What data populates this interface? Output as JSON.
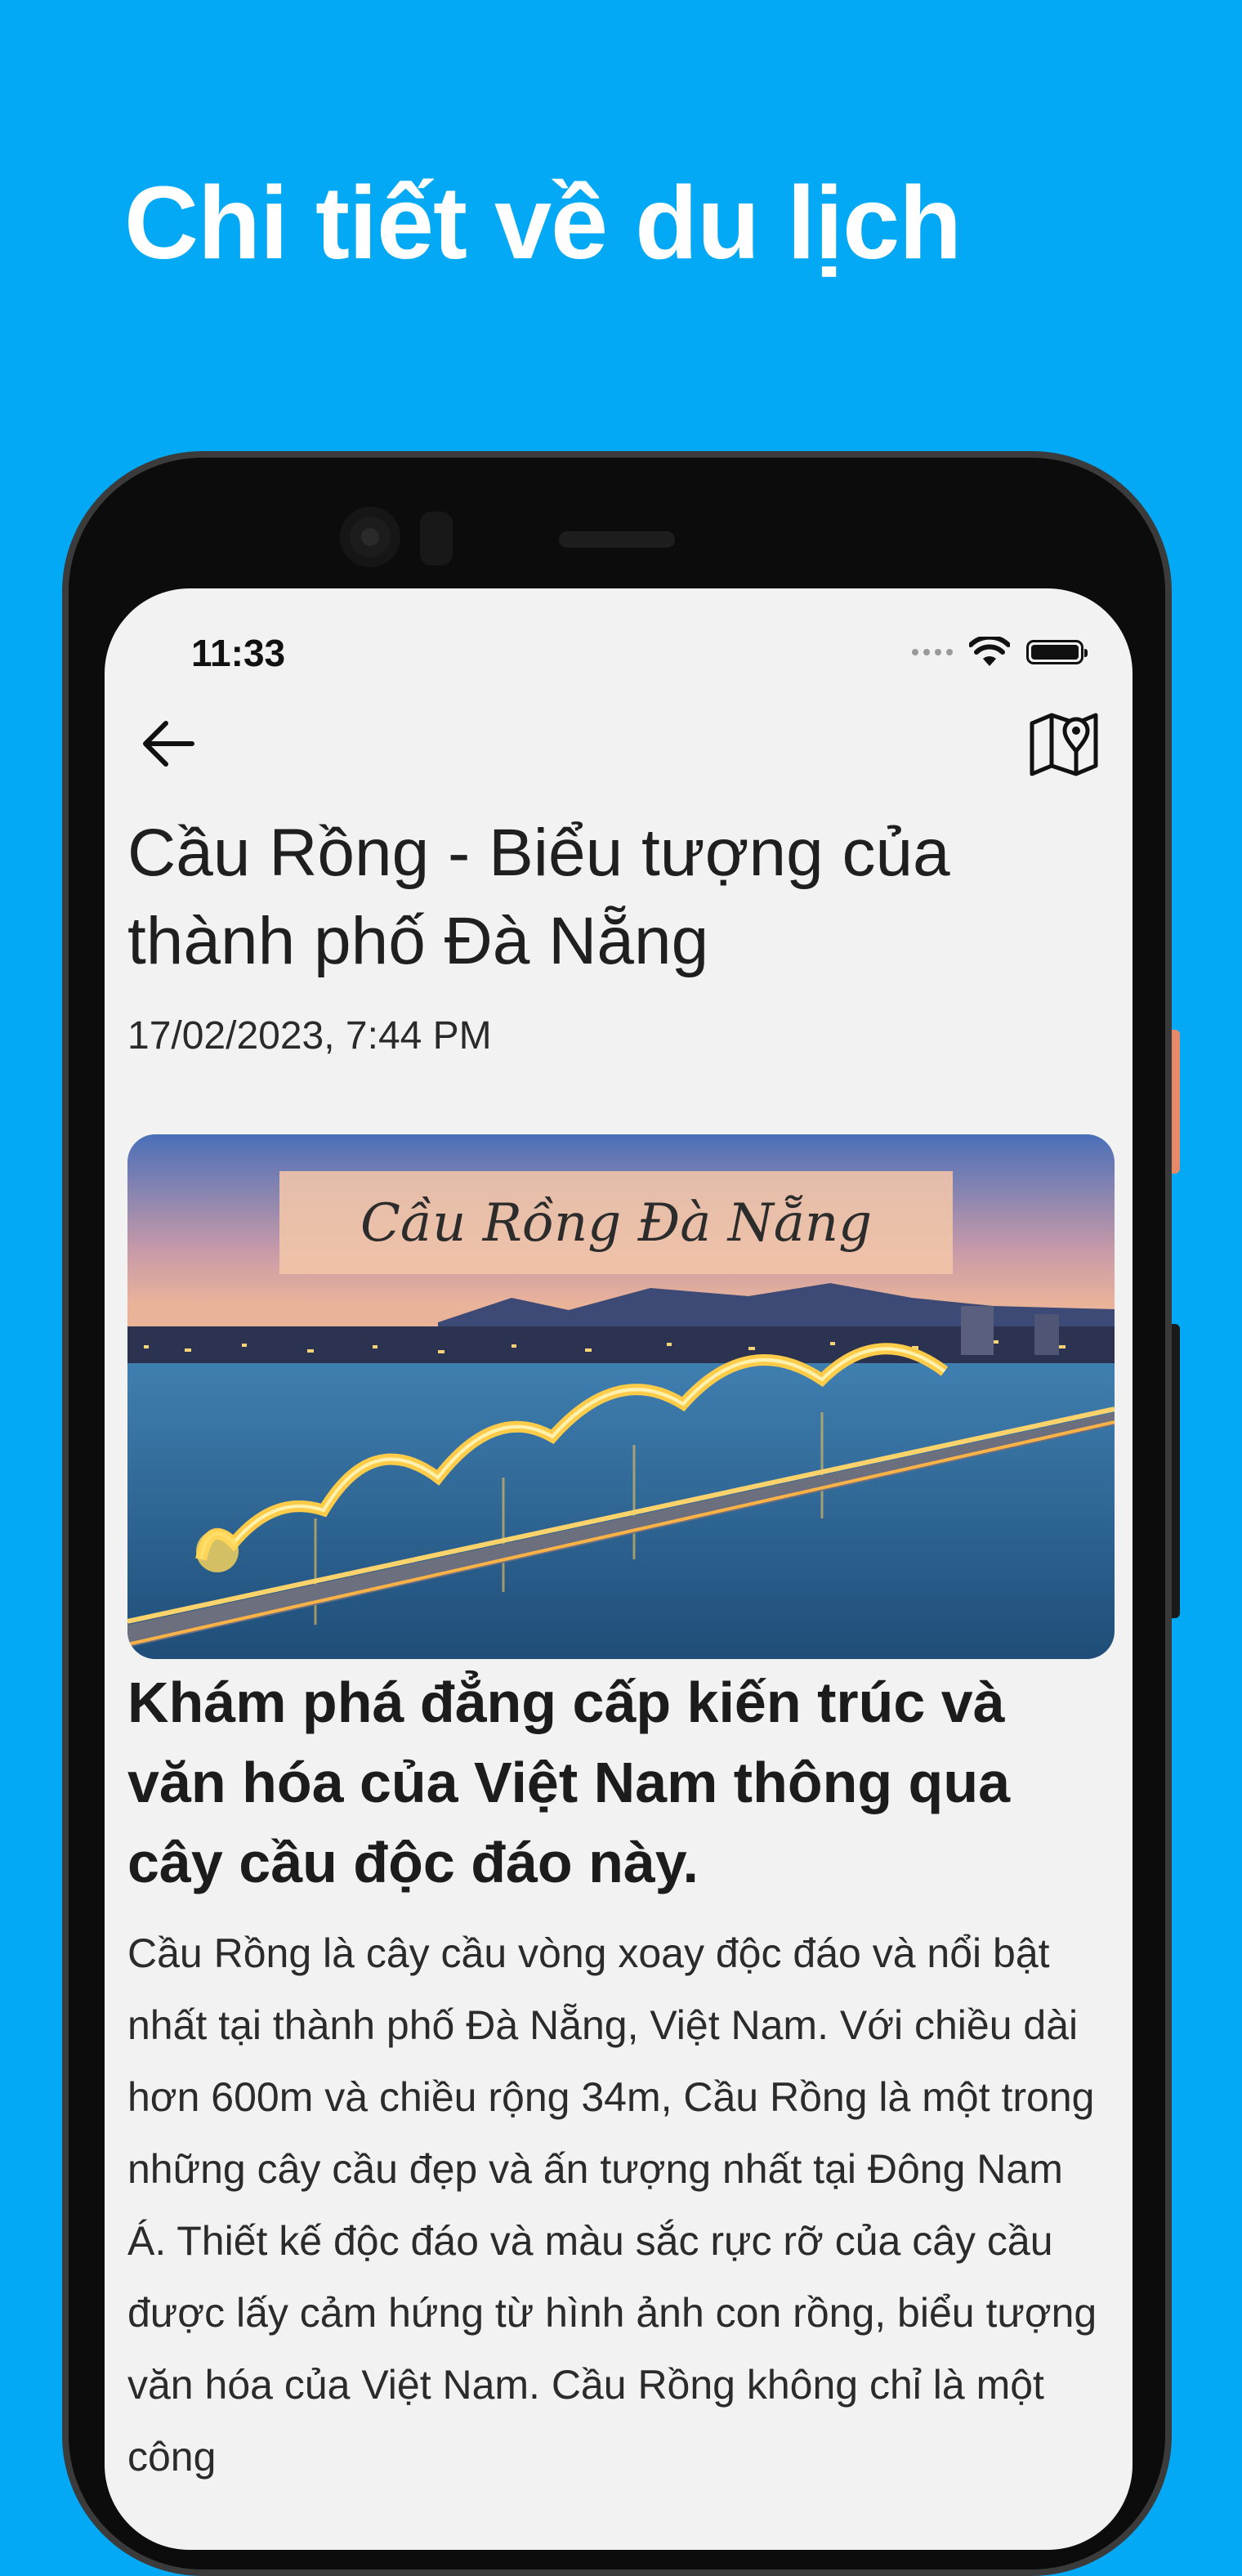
{
  "promo": {
    "title": "Chi tiết về du lịch"
  },
  "status_bar": {
    "time": "11:33"
  },
  "app_bar": {
    "back_icon": "arrow-left-icon",
    "map_icon": "map-pin-icon"
  },
  "article": {
    "title": "Cầu Rồng - Biểu tượng của thành phố Đà Nẵng",
    "date": "17/02/2023, 7:44 PM",
    "image_caption": "Cầu Rồng Đà Nẵng",
    "subtitle": "Khám phá đẳng cấp kiến trúc và văn hóa của Việt Nam thông qua cây cầu độc đáo này.",
    "body": "Cầu Rồng là cây cầu vòng xoay độc đáo và nổi bật nhất tại thành phố Đà Nẵng, Việt Nam. Với chiều dài hơn 600m và chiều rộng 34m, Cầu Rồng là một trong những cây cầu đẹp và ấn tượng nhất tại Đông Nam Á. Thiết kế độc đáo và màu sắc rực rỡ của cây cầu được lấy cảm hứng từ hình ảnh con rồng, biểu tượng văn hóa của Việt Nam. Cầu Rồng không chỉ là một công"
  },
  "colors": {
    "background": "#03A9F4",
    "screen": "#F3F2F2",
    "text": "#1f1f1f"
  }
}
